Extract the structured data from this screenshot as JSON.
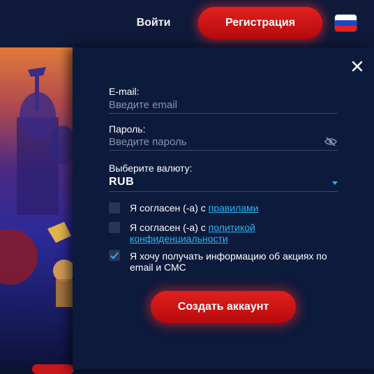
{
  "header": {
    "login_label": "Войти",
    "register_label": "Регистрация",
    "language_flag": "russia-flag-icon"
  },
  "form": {
    "email": {
      "label": "E-mail:",
      "placeholder": "Введите email",
      "value": ""
    },
    "password": {
      "label": "Пароль:",
      "placeholder": "Введите пароль",
      "value": "",
      "toggle_icon": "eye-slash-icon"
    },
    "currency": {
      "label": "Выберите валюту:",
      "selected": "RUB"
    },
    "checkboxes": [
      {
        "prefix": "Я согласен (-а) с ",
        "link": "правилами",
        "checked": false
      },
      {
        "prefix": "Я согласен (-а) с ",
        "link": "политикой конфиденциальности",
        "checked": false
      },
      {
        "text": "Я хочу получать информацию об акциях по email и СМС",
        "checked": true
      }
    ],
    "submit_label": "Создать аккаунт"
  },
  "colors": {
    "accent_red": "#d3181b",
    "link_blue": "#29b6f6",
    "panel_bg": "#0c1a3c",
    "header_bg": "#0f1a3a"
  }
}
